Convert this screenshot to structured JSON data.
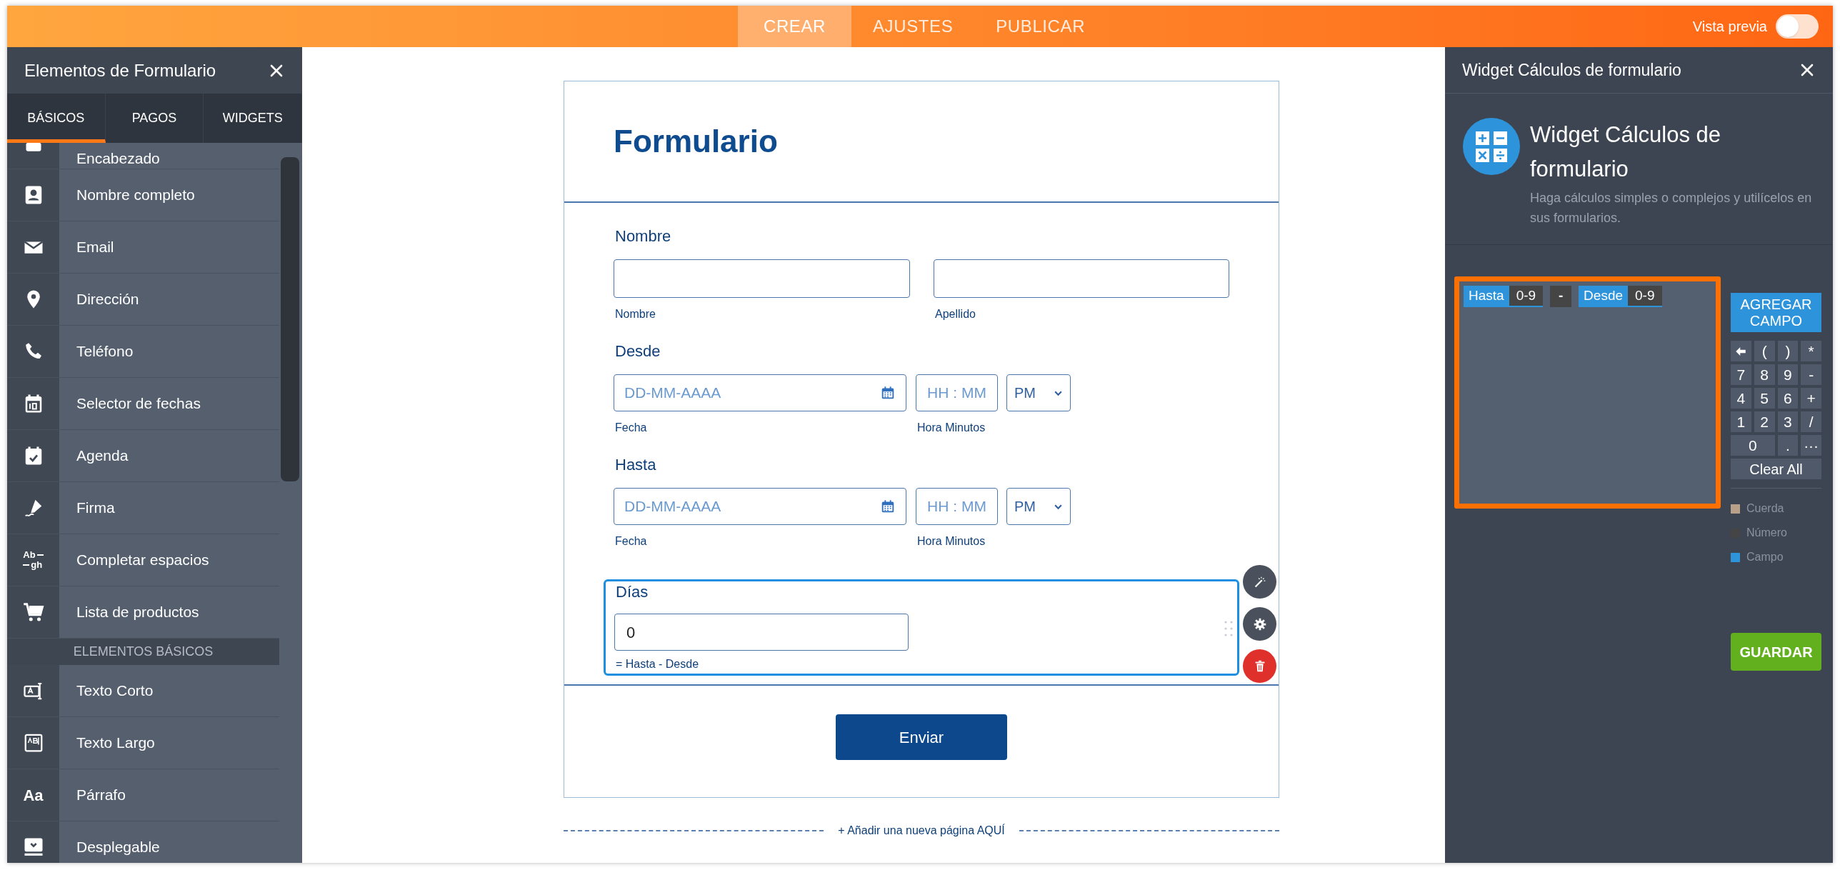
{
  "top_bar": {
    "tabs": [
      {
        "label": "CREAR",
        "selected": true
      },
      {
        "label": "AJUSTES",
        "selected": false
      },
      {
        "label": "PUBLICAR",
        "selected": false
      }
    ],
    "preview": {
      "label": "Vista previa",
      "on": false
    }
  },
  "left_panel": {
    "title": "Elementos de Formulario",
    "tabs": [
      {
        "label": "BÁSICOS",
        "selected": true
      },
      {
        "label": "PAGOS",
        "selected": false
      },
      {
        "label": "WIDGETS",
        "selected": false
      }
    ],
    "items": [
      {
        "kind": "item",
        "label": "Encabezado"
      },
      {
        "kind": "item",
        "label": "Nombre completo"
      },
      {
        "kind": "item",
        "label": "Email"
      },
      {
        "kind": "item",
        "label": "Dirección"
      },
      {
        "kind": "item",
        "label": "Teléfono"
      },
      {
        "kind": "item",
        "label": "Selector de fechas"
      },
      {
        "kind": "item",
        "label": "Agenda"
      },
      {
        "kind": "item",
        "label": "Firma"
      },
      {
        "kind": "item",
        "label": "Completar espacios",
        "glyph": [
          "Ab",
          "gh"
        ]
      },
      {
        "kind": "item",
        "label": "Lista de productos"
      },
      {
        "kind": "section",
        "label": "ELEMENTOS BÁSICOS"
      },
      {
        "kind": "item",
        "label": "Texto Corto"
      },
      {
        "kind": "item",
        "label": "Texto Largo"
      },
      {
        "kind": "item",
        "label": "Párrafo",
        "glyph": [
          "Aa"
        ]
      },
      {
        "kind": "item",
        "label": "Desplegable"
      }
    ]
  },
  "form": {
    "title": "Formulario",
    "fields": [
      {
        "kind": "fullname",
        "label": "Nombre",
        "sublabels": [
          "Nombre",
          "Apellido"
        ],
        "selected": false
      },
      {
        "kind": "datetime",
        "label": "Desde",
        "date_placeholder": "DD-MM-AAAA",
        "time_placeholder": "HH : MM",
        "ampm": "PM",
        "sublabels": [
          "Fecha",
          "Hora Minutos"
        ],
        "selected": false
      },
      {
        "kind": "datetime",
        "label": "Hasta",
        "date_placeholder": "DD-MM-AAAA",
        "time_placeholder": "HH : MM",
        "ampm": "PM",
        "sublabels": [
          "Fecha",
          "Hora Minutos"
        ],
        "selected": false
      },
      {
        "kind": "number",
        "label": "Días",
        "value": "0",
        "hint": "= Hasta - Desde",
        "selected": true
      }
    ],
    "submit": "Enviar",
    "add_page": "+ Añadir una nueva página AQUÍ"
  },
  "right_panel": {
    "title": "Widget Cálculos de formulario",
    "widget_name": "Widget Cálculos de formulario",
    "description": "Haga cálculos simples o complejos y utilícelos en sus formularios.",
    "formula": [
      {
        "kind": "field",
        "label": "Hasta",
        "tag": "0-9"
      },
      {
        "kind": "operator",
        "label": "-"
      },
      {
        "kind": "field",
        "label": "Desde",
        "tag": "0-9"
      }
    ],
    "add_field": "AGREGAR CAMPO",
    "keys": [
      {
        "kind": "backspace"
      },
      {
        "kind": "key",
        "label": "("
      },
      {
        "kind": "key",
        "label": ")"
      },
      {
        "kind": "key",
        "label": "*"
      },
      {
        "kind": "key",
        "label": "7"
      },
      {
        "kind": "key",
        "label": "8"
      },
      {
        "kind": "key",
        "label": "9"
      },
      {
        "kind": "key",
        "label": "-"
      },
      {
        "kind": "key",
        "label": "4"
      },
      {
        "kind": "key",
        "label": "5"
      },
      {
        "kind": "key",
        "label": "6"
      },
      {
        "kind": "key",
        "label": "+"
      },
      {
        "kind": "key",
        "label": "1"
      },
      {
        "kind": "key",
        "label": "2"
      },
      {
        "kind": "key",
        "label": "3"
      },
      {
        "kind": "key",
        "label": "/"
      },
      {
        "kind": "wide",
        "label": "0"
      },
      {
        "kind": "key",
        "label": "."
      },
      {
        "kind": "key",
        "label": "···"
      }
    ],
    "clear": "Clear All",
    "legend": [
      {
        "label": "Cuerda",
        "color": "#b9a088"
      },
      {
        "label": "Número",
        "color": "#454545"
      },
      {
        "label": "Campo",
        "color": "#2d94dc"
      }
    ],
    "save": "GUARDAR"
  }
}
